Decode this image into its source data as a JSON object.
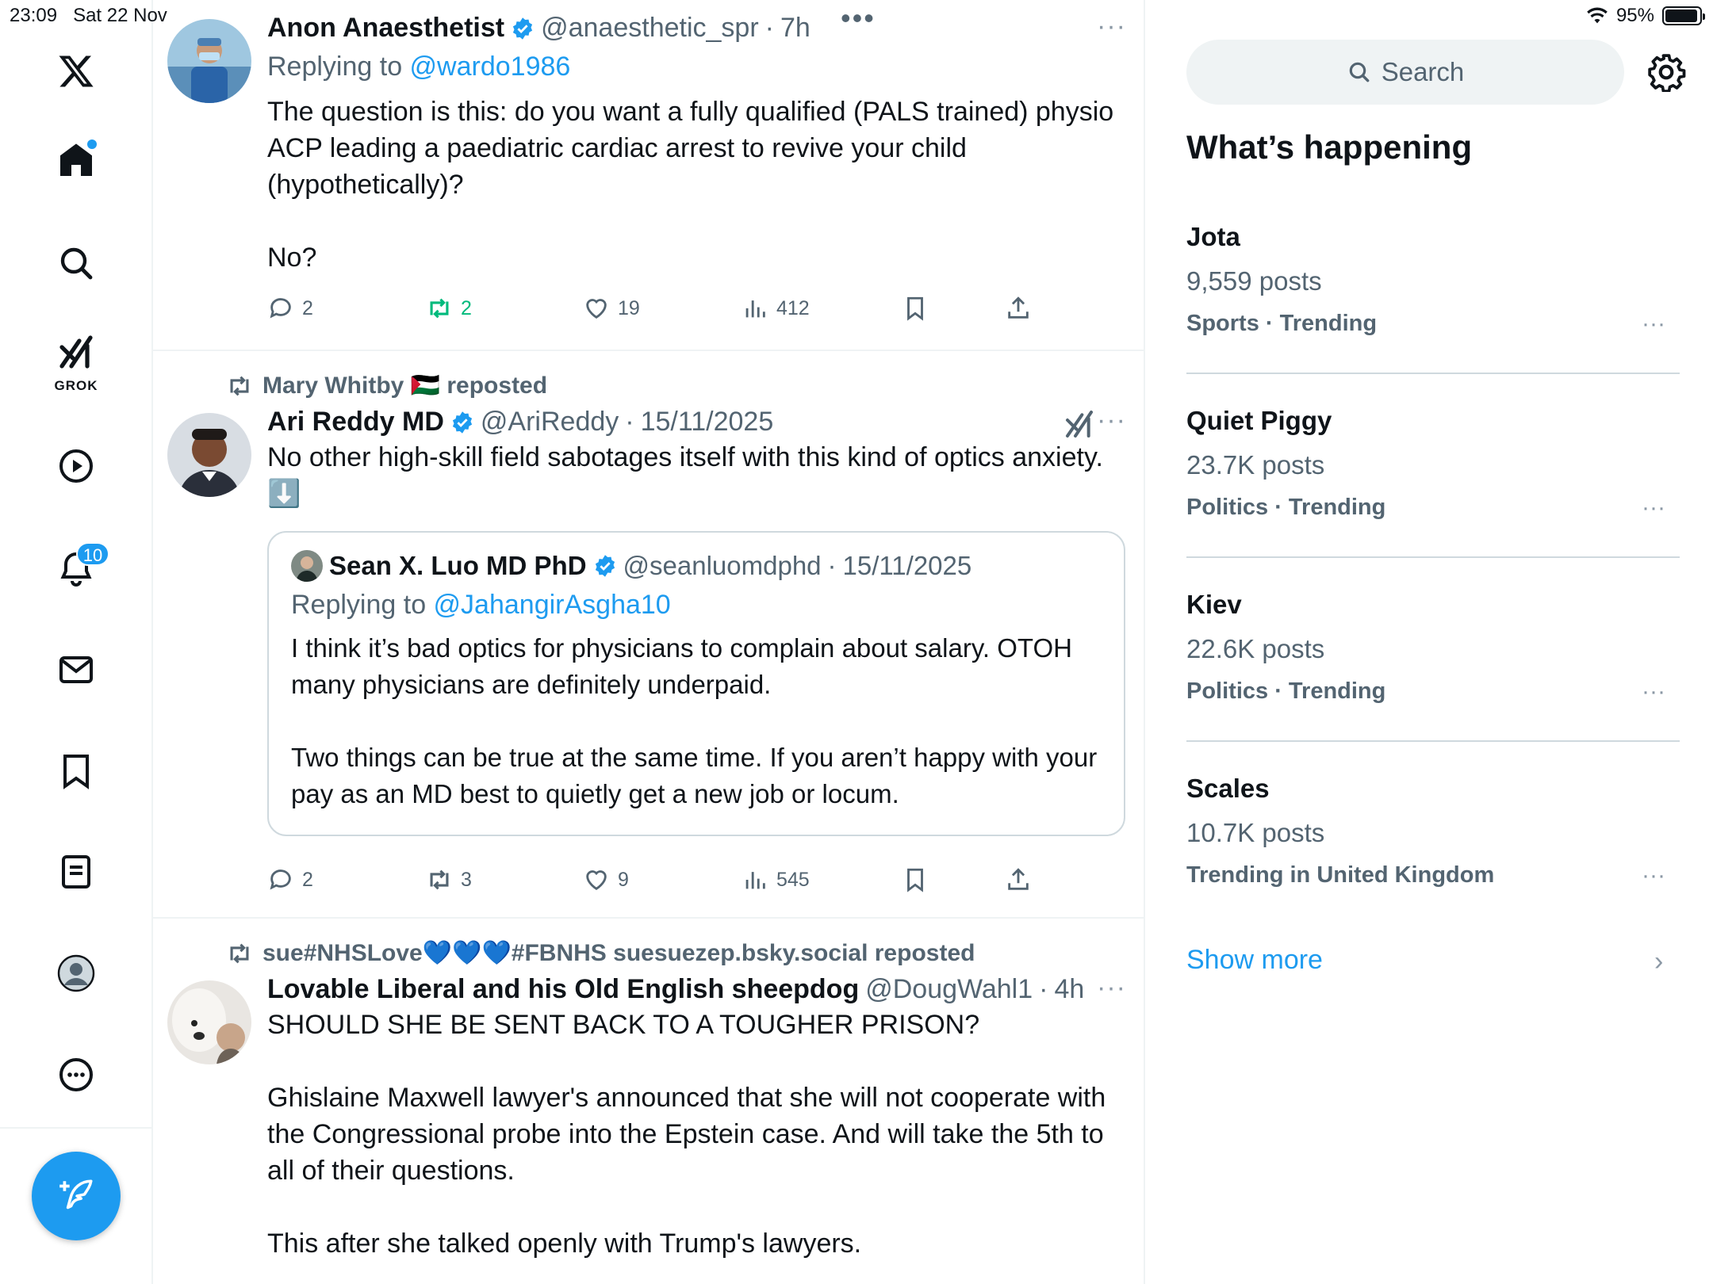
{
  "status_bar": {
    "time": "23:09",
    "date": "Sat 22 Nov",
    "battery": "95%",
    "battery_level": 0.95
  },
  "nav": {
    "grok_label": "GROK",
    "notifications_badge": "10"
  },
  "tweets": [
    {
      "name": "Anon Anaesthetist",
      "handle": "@anaesthetic_spr",
      "time": "7h",
      "replying_prefix": "Replying to ",
      "replying_to": "@wardo1986",
      "text": "The question is this: do you want a fully qualified (PALS trained) physio ACP leading a paediatric cardiac arrest to revive your child (hypothetically)?\n\nNo?",
      "replies": "2",
      "reposts": "2",
      "likes": "19",
      "views": "412"
    },
    {
      "reposted_by": "Mary Whitby 🇵🇸 reposted",
      "name": "Ari Reddy MD",
      "handle": "@AriReddy",
      "time": "15/11/2025",
      "text": "No other high-skill field sabotages itself with this kind of optics anxiety. ⬇️",
      "quote": {
        "name": "Sean X. Luo MD PhD",
        "handle": "@seanluomdphd",
        "time": "15/11/2025",
        "replying_prefix": "Replying to ",
        "replying_to": "@JahangirAsgha10",
        "text": "I think it’s bad optics for physicians to complain about salary. OTOH many physicians are definitely underpaid.\n\nTwo things can be true at the same time. If you aren’t happy with your pay as an MD best to quietly get a new job or locum."
      },
      "replies": "2",
      "reposts": "3",
      "likes": "9",
      "views": "545"
    },
    {
      "reposted_by": "sue#NHSLove💙💙💙#FBNHS suesuezep.bsky.social reposted",
      "name": "Lovable Liberal and his Old English sheepdog",
      "handle": "@DougWahl1",
      "time": "4h",
      "text": "SHOULD SHE BE SENT BACK TO A TOUGHER PRISON?\n\nGhislaine Maxwell lawyer's announced that she will not cooperate with the Congressional probe into the Epstein case. And will take the 5th to all of their questions.\n\nThis after she talked openly with Trump's lawyers."
    }
  ],
  "sidebar": {
    "search_placeholder": "Search",
    "section_title": "What’s happening",
    "trends": [
      {
        "name": "Jota",
        "posts": "9,559 posts",
        "category": "Sports · Trending"
      },
      {
        "name": "Quiet Piggy",
        "posts": "23.7K posts",
        "category": "Politics · Trending"
      },
      {
        "name": "Kiev",
        "posts": "22.6K posts",
        "category": "Politics · Trending"
      },
      {
        "name": "Scales",
        "posts": "10.7K posts",
        "category": "Trending in United Kingdom"
      }
    ],
    "show_more": "Show more"
  },
  "colors": {
    "accent": "#1d9bf0",
    "repost_active": "#00ba7c",
    "text_secondary": "#536471"
  }
}
